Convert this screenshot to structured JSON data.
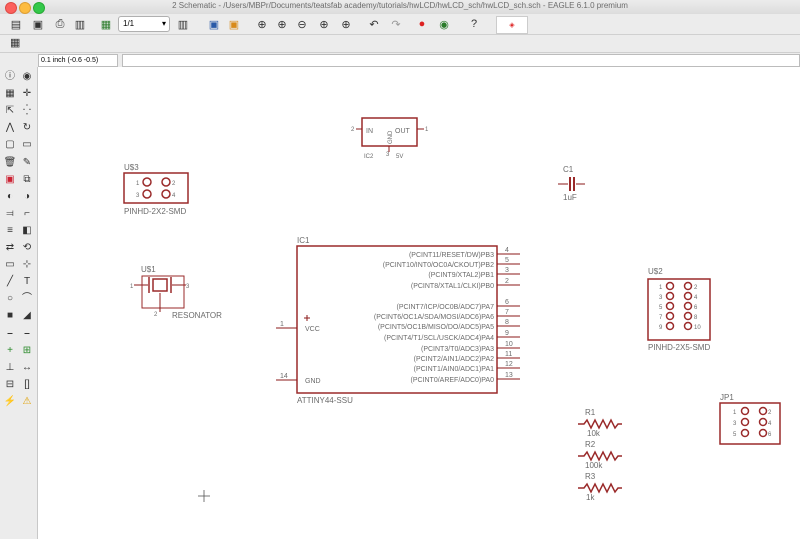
{
  "window": {
    "title": "2 Schematic - /Users/MBPr/Documents/teatsfab academy/tutorials/hwLCD/hwLCD_sch/hwLCD_sch.sch - EAGLE 6.1.0 premium"
  },
  "toolbar": {
    "sheet_select": "1/1",
    "icons": [
      "open-icon",
      "save-icon",
      "print-icon",
      "cam-icon",
      "sheet-select",
      "board-icon",
      "script-icon",
      "run-icon",
      "zoom-fit-icon",
      "zoom-in-icon",
      "zoom-out-icon",
      "zoom-redraw-icon",
      "zoom-area-icon",
      "undo-icon",
      "redo-icon",
      "stop-icon",
      "go-icon",
      "help-icon",
      "design-link-icon"
    ]
  },
  "command": {
    "grid_label": "0.1 inch (-0.6 -0.5)",
    "input_value": ""
  },
  "schematic": {
    "ic2": {
      "name": "IC2",
      "value": "5V",
      "pin_in": "IN",
      "pin_out": "OUT",
      "pin_gnd": "GND",
      "pin_in_num": "2",
      "pin_out_num": "1",
      "pin_gnd_num": "3"
    },
    "u3": {
      "name": "U$3",
      "value": "PINHD-2X2-SMD",
      "pins": [
        "1",
        "2",
        "3",
        "4"
      ]
    },
    "c1": {
      "name": "C1",
      "value": "1uF"
    },
    "ic1": {
      "name": "IC1",
      "value": "ATTINY44-SSU",
      "left_pins": [
        {
          "num": "1",
          "label": "VCC"
        },
        {
          "num": "14",
          "label": "GND"
        }
      ],
      "right_pins": [
        {
          "num": "4",
          "label": "(PCINT11/RESET/DW)PB3"
        },
        {
          "num": "5",
          "label": "(PCINT10/INT0/OC0A/CKOUT)PB2"
        },
        {
          "num": "3",
          "label": "(PCINT9/XTAL2)PB1"
        },
        {
          "num": "2",
          "label": "(PCINT8/XTAL1/CLKI)PB0"
        },
        {
          "num": "6",
          "label": "(PCINT7/ICP/OC0B/ADC7)PA7"
        },
        {
          "num": "7",
          "label": "(PCINT6/OC1A/SDA/MOSI/ADC6)PA6"
        },
        {
          "num": "8",
          "label": "(PCINT5/OC1B/MISO/DO/ADC5)PA5"
        },
        {
          "num": "9",
          "label": "(PCINT4/T1/SCL/USCK/ADC4)PA4"
        },
        {
          "num": "10",
          "label": "(PCINT3/T0/ADC3)PA3"
        },
        {
          "num": "11",
          "label": "(PCINT2/AIN1/ADC2)PA2"
        },
        {
          "num": "12",
          "label": "(PCINT1/AIN0/ADC1)PA1"
        },
        {
          "num": "13",
          "label": "(PCINT0/AREF/ADC0)PA0"
        }
      ]
    },
    "u1": {
      "name": "U$1",
      "value": "RESONATOR",
      "pin_1": "1",
      "pin_2": "2",
      "pin_3": "3"
    },
    "u2": {
      "name": "U$2",
      "value": "PINHD-2X5-SMD",
      "pins": [
        "1",
        "2",
        "3",
        "4",
        "5",
        "6",
        "7",
        "8",
        "9",
        "10"
      ]
    },
    "jp1": {
      "name": "JP1",
      "pins": [
        "1",
        "2",
        "3",
        "4",
        "5",
        "6"
      ]
    },
    "r1": {
      "name": "R1",
      "value": "10k"
    },
    "r2": {
      "name": "R2",
      "value": "100k"
    },
    "r3": {
      "name": "R3",
      "value": "1k"
    }
  },
  "colors": {
    "part": "#9a2a2a",
    "pin": "#8b1a1a",
    "text": "#6b6b6b",
    "title_text": "#6c6c6c"
  }
}
